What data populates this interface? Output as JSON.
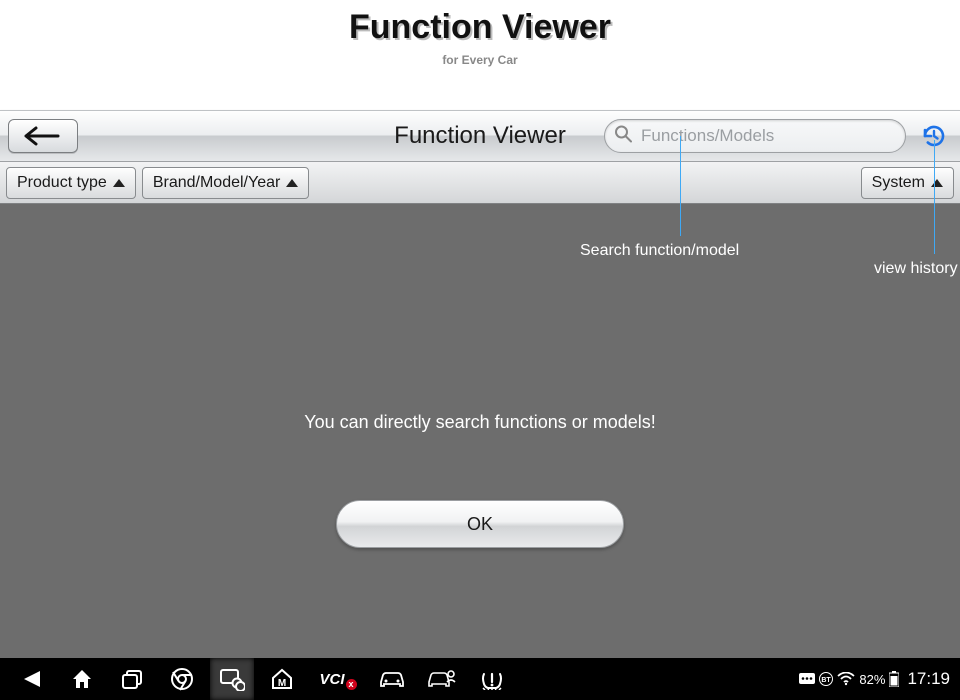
{
  "header": {
    "title": "Function Viewer",
    "subtitle": "for Every Car"
  },
  "toolbar": {
    "title": "Function Viewer",
    "search_placeholder": "Functions/Models"
  },
  "filters": {
    "product_type": "Product type",
    "brand_model_year": "Brand/Model/Year",
    "system": "System"
  },
  "annotations": {
    "search": "Search function/model",
    "history": "view history"
  },
  "main": {
    "message": "You can directly search functions or models!",
    "ok_label": "OK"
  },
  "statusbar": {
    "battery_pct": "82%",
    "clock": "17:19"
  }
}
